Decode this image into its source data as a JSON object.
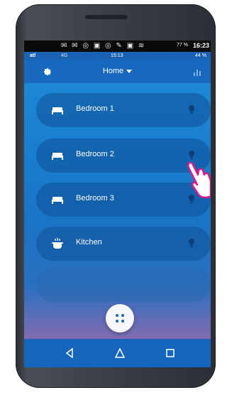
{
  "statusbar": {
    "battery": "77 %",
    "time": "16:23"
  },
  "substatus": {
    "signal": "atl",
    "network": "4G",
    "time": "15:13",
    "battery": "44 %"
  },
  "header": {
    "title": "Home"
  },
  "rooms": [
    {
      "label": "Bedroom 1",
      "icon": "bed-icon"
    },
    {
      "label": "Bedroom 2",
      "icon": "bed-icon"
    },
    {
      "label": "Bedroom 3",
      "icon": "bed-icon"
    },
    {
      "label": "Kitchen",
      "icon": "cooking-pot-icon"
    }
  ],
  "colors": {
    "accent": "#1769be",
    "room_pill": "#0f5096",
    "fab": "#f7f7fb"
  }
}
